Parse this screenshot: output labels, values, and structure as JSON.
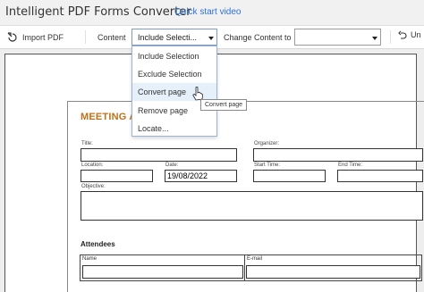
{
  "titlebar": {
    "app_title": "Intelligent PDF Forms Converter",
    "quick_start_link": "Quick start video"
  },
  "toolbar": {
    "import_label": "Import PDF",
    "content_label": "Content",
    "content_selected": "Include Selecti...",
    "change_content_label": "Change Content to",
    "change_content_selected": "",
    "undo_label": "Un"
  },
  "content_dropdown": {
    "options": [
      "Include Selection",
      "Exclude Selection",
      "Convert page",
      "Remove page",
      "Locate..."
    ],
    "hovered": "Convert page"
  },
  "tooltip": "Convert page",
  "form": {
    "title": "MEETING AG",
    "labels": {
      "title": "Title:",
      "organizer": "Organizer:",
      "location": "Location:",
      "date": "Date:",
      "start_time": "Start Time:",
      "end_time": "End Time:",
      "objective": "Objective:"
    },
    "values": {
      "date": "19/08/2022"
    },
    "attendees": {
      "heading": "Attendees",
      "columns": [
        "Name",
        "E-mail"
      ]
    }
  },
  "colors": {
    "form_title": "#c0701a",
    "link": "#2c72d8",
    "dropdown_hover": "#e6f0fb"
  }
}
